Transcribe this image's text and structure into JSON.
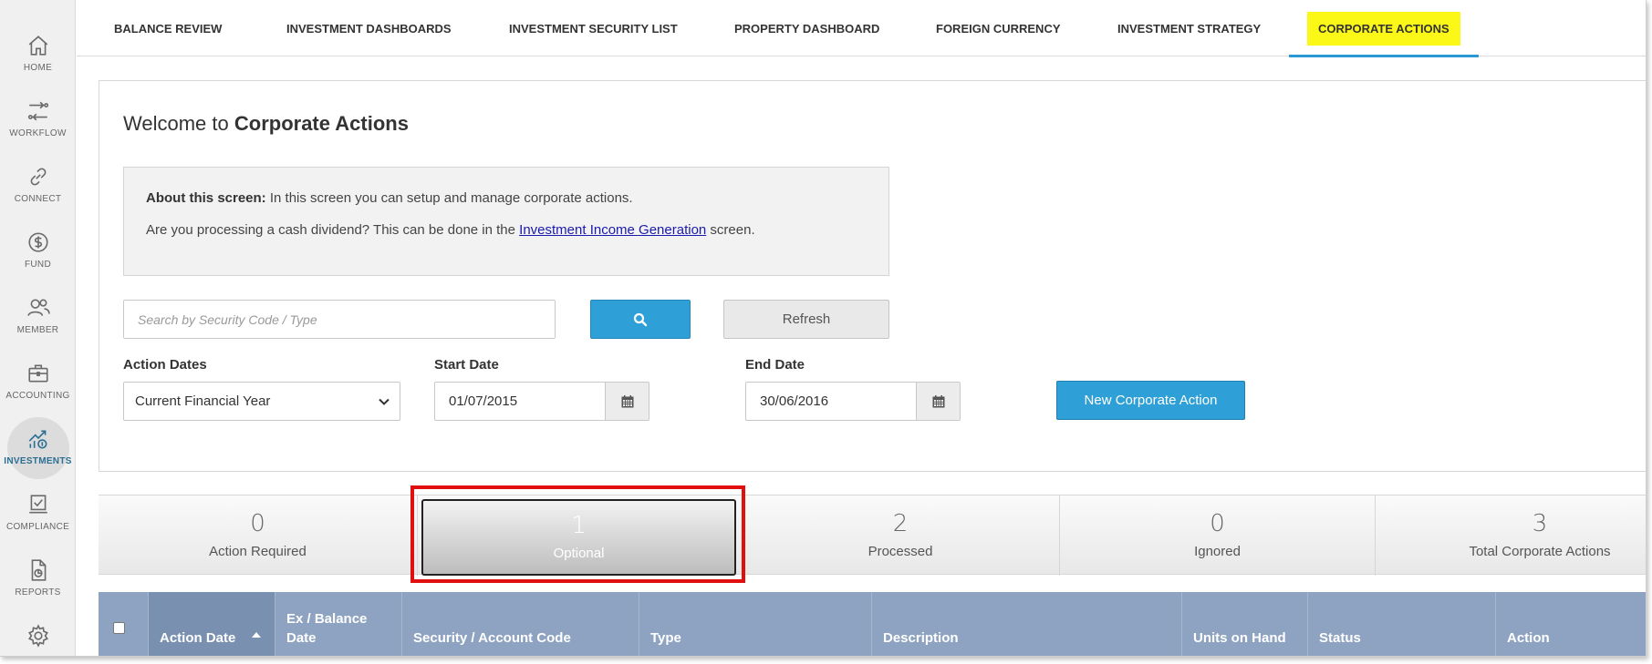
{
  "sidebar": {
    "items": [
      {
        "label": "HOME",
        "icon": "home-icon"
      },
      {
        "label": "WORKFLOW",
        "icon": "workflow-icon"
      },
      {
        "label": "CONNECT",
        "icon": "link-icon"
      },
      {
        "label": "FUND",
        "icon": "dollar-circle-icon"
      },
      {
        "label": "MEMBER",
        "icon": "members-icon"
      },
      {
        "label": "ACCOUNTING",
        "icon": "briefcase-icon"
      },
      {
        "label": "INVESTMENTS",
        "icon": "investments-chart-icon",
        "active": true
      },
      {
        "label": "COMPLIANCE",
        "icon": "compliance-check-icon"
      },
      {
        "label": "REPORTS",
        "icon": "report-document-icon"
      },
      {
        "label": "",
        "icon": "gear-icon"
      }
    ]
  },
  "topnav": {
    "tabs": [
      {
        "label": "BALANCE REVIEW"
      },
      {
        "label": "INVESTMENT DASHBOARDS"
      },
      {
        "label": "INVESTMENT SECURITY LIST"
      },
      {
        "label": "PROPERTY DASHBOARD"
      },
      {
        "label": "FOREIGN CURRENCY"
      },
      {
        "label": "INVESTMENT STRATEGY"
      },
      {
        "label": "CORPORATE ACTIONS",
        "active": true
      }
    ]
  },
  "main": {
    "welcome_prefix": "Welcome to",
    "welcome_title": "Corporate Actions",
    "about_label": "About this screen:",
    "about_text": " In this screen you can setup and manage corporate actions.",
    "cash_prefix": "Are you processing a cash dividend? This can be done in the ",
    "cash_link": "Investment Income Generation",
    "cash_suffix": " screen.",
    "search_placeholder": "Search by Security Code / Type",
    "refresh_label": "Refresh",
    "action_dates_label": "Action Dates",
    "action_dates_value": "Current Financial Year",
    "start_date_label": "Start Date",
    "start_date_value": "01/07/2015",
    "end_date_label": "End Date",
    "end_date_value": "30/06/2016",
    "new_action_label": "New Corporate Action"
  },
  "stats": [
    {
      "count": "0",
      "label": "Action Required"
    },
    {
      "count": "1",
      "label": "Optional",
      "selected": true
    },
    {
      "count": "2",
      "label": "Processed"
    },
    {
      "count": "0",
      "label": "Ignored"
    },
    {
      "count": "3",
      "label": "Total Corporate Actions"
    }
  ],
  "table": {
    "columns": [
      "Action Date",
      "Ex / Balance Date",
      "Security / Account Code",
      "Type",
      "Description",
      "Units on Hand",
      "Status",
      "Action"
    ]
  },
  "colors": {
    "accent_blue": "#2f9fd8",
    "active_tab_highlight": "#fbf717",
    "table_header": "#8ea3c1",
    "annotation_red": "#e01010"
  }
}
